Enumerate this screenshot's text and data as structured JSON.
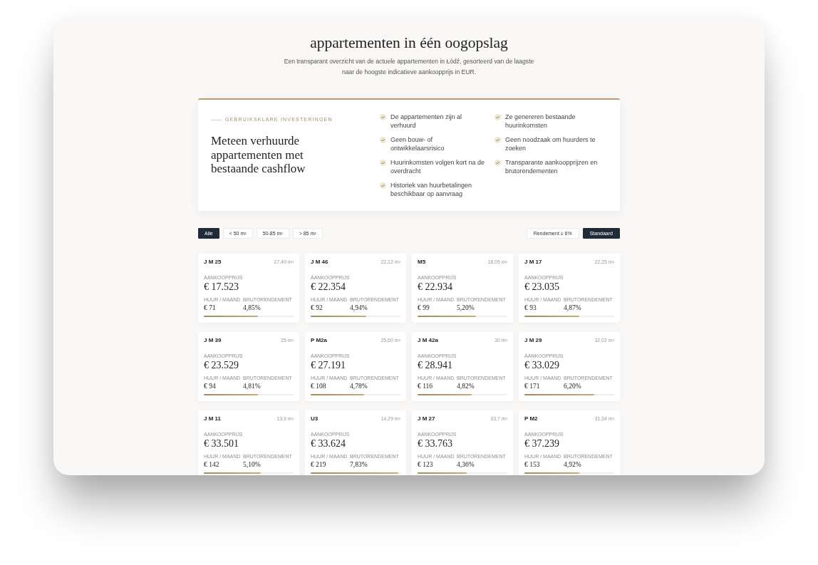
{
  "header": {
    "title": "appartementen in één oogopslag",
    "subtitle": "Een transparant overzicht van de actuele appartementen in Łódź, gesorteerd van de laagste naar de hoogste indicatieve aankoopprijs in EUR."
  },
  "info_card": {
    "eyebrow": "GEBRUIKSKLARE INVESTERINGEN",
    "heading": "Meteen verhuurde appartementen met bestaande cashflow",
    "benefits": [
      "De appartementen zijn al verhuurd",
      "Geen bouw- of ontwikkelaarsrisico",
      "Huurinkomsten volgen kort na de overdracht",
      "Historiek van huurbetalingen beschikbaar op aanvraag",
      "Ze genereren bestaande huurinkomsten",
      "Geen noodzaak om huurders te zoeken",
      "Transparante aankoopprijzen en brutorendementen"
    ]
  },
  "size_filters": [
    {
      "label": "Alle",
      "selected": true
    },
    {
      "label": "< 50 m²",
      "selected": false
    },
    {
      "label": "50-85 m²",
      "selected": false
    },
    {
      "label": "> 85 m²",
      "selected": false
    }
  ],
  "sort_options": [
    {
      "label": "Rendement ≥ 6%",
      "selected": false
    },
    {
      "label": "Standaard",
      "selected": true
    }
  ],
  "apartments": [
    {
      "name": "J M 25",
      "area": "17,49 m²",
      "price_label": "AANKOOPPRIJS",
      "price": "€ 17.523",
      "rent_label": "HUUR / MAAND",
      "rent": "€ 71",
      "yield_label": "BRUTORENDEMENT",
      "yield": "4,85%",
      "level": 0.606
    },
    {
      "name": "J M 46",
      "area": "22,12 m²",
      "price_label": "AANKOOPPRIJS",
      "price": "€ 22.354",
      "rent_label": "HUUR / MAAND",
      "rent": "€ 92",
      "yield_label": "BRUTORENDEMENT",
      "yield": "4,94%",
      "level": 0.618
    },
    {
      "name": "M5",
      "area": "18,05 m²",
      "price_label": "AANKOOPPRIJS",
      "price": "€ 22.934",
      "rent_label": "HUUR / MAAND",
      "rent": "€ 99",
      "yield_label": "BRUTORENDEMENT",
      "yield": "5,20%",
      "level": 0.65
    },
    {
      "name": "J M 17",
      "area": "22,25 m²",
      "price_label": "AANKOOPPRIJS",
      "price": "€ 23.035",
      "rent_label": "HUUR / MAAND",
      "rent": "€ 93",
      "yield_label": "BRUTORENDEMENT",
      "yield": "4,87%",
      "level": 0.609
    },
    {
      "name": "J M 39",
      "area": "25 m²",
      "price_label": "AANKOOPPRIJS",
      "price": "€ 23.529",
      "rent_label": "HUUR / MAAND",
      "rent": "€ 94",
      "yield_label": "BRUTORENDEMENT",
      "yield": "4,81%",
      "level": 0.601
    },
    {
      "name": "P M2a",
      "area": "25,60 m²",
      "price_label": "AANKOOPPRIJS",
      "price": "€ 27.191",
      "rent_label": "HUUR / MAAND",
      "rent": "€ 108",
      "yield_label": "BRUTORENDEMENT",
      "yield": "4,78%",
      "level": 0.598
    },
    {
      "name": "J M 42a",
      "area": "30 m²",
      "price_label": "AANKOOPPRIJS",
      "price": "€ 28.941",
      "rent_label": "HUUR / MAAND",
      "rent": "€ 116",
      "yield_label": "BRUTORENDEMENT",
      "yield": "4,82%",
      "level": 0.603
    },
    {
      "name": "J M 29",
      "area": "32,02 m²",
      "price_label": "AANKOOPPRIJS",
      "price": "€ 33.029",
      "rent_label": "HUUR / MAAND",
      "rent": "€ 171",
      "yield_label": "BRUTORENDEMENT",
      "yield": "6,20%",
      "level": 0.775
    },
    {
      "name": "J M 11",
      "area": "13,9 m²",
      "price_label": "AANKOOPPRIJS",
      "price": "€ 33.501",
      "rent_label": "HUUR / MAAND",
      "rent": "€ 142",
      "yield_label": "BRUTORENDEMENT",
      "yield": "5,10%",
      "level": 0.638
    },
    {
      "name": "U3",
      "area": "14,29 m²",
      "price_label": "AANKOOPPRIJS",
      "price": "€ 33.624",
      "rent_label": "HUUR / MAAND",
      "rent": "€ 219",
      "yield_label": "BRUTORENDEMENT",
      "yield": "7,83%",
      "level": 0.979
    },
    {
      "name": "J M 27",
      "area": "33,7 m²",
      "price_label": "AANKOOPPRIJS",
      "price": "€ 33.763",
      "rent_label": "HUUR / MAAND",
      "rent": "€ 123",
      "yield_label": "BRUTORENDEMENT",
      "yield": "4,36%",
      "level": 0.545
    },
    {
      "name": "P M2",
      "area": "31,34 m²",
      "price_label": "AANKOOPPRIJS",
      "price": "€ 37.239",
      "rent_label": "HUUR / MAAND",
      "rent": "€ 153",
      "yield_label": "BRUTORENDEMENT",
      "yield": "4,92%",
      "level": 0.615
    }
  ]
}
